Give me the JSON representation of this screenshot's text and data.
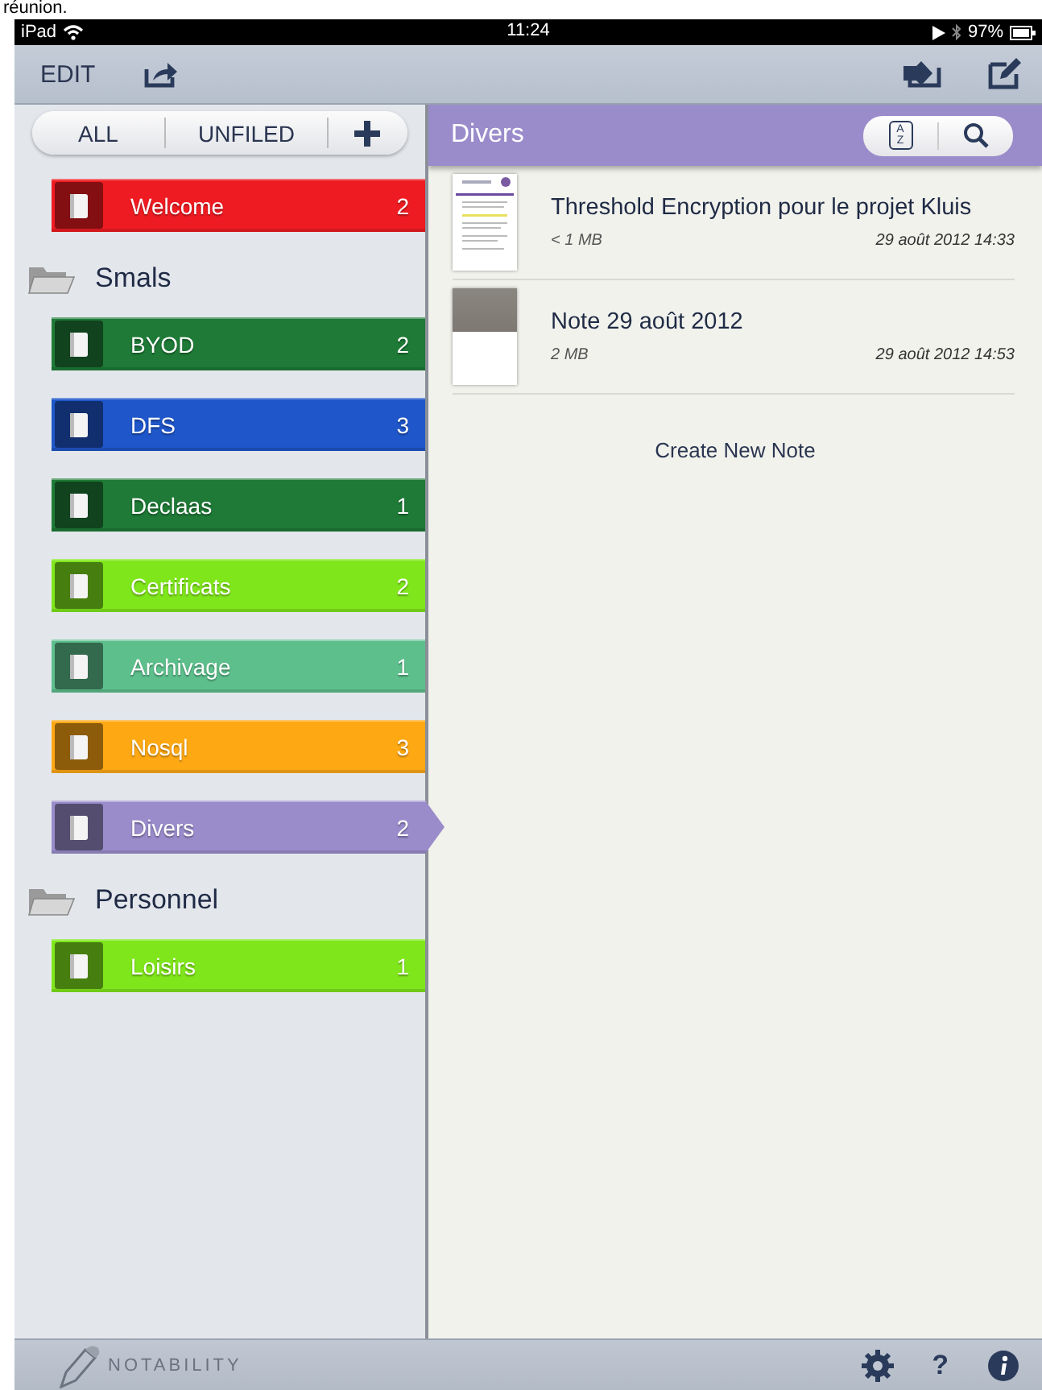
{
  "cropped_caption": "réunion.",
  "status_bar": {
    "device": "iPad",
    "time": "11:24",
    "battery": "97%"
  },
  "toolbar": {
    "edit": "EDIT"
  },
  "sidebar": {
    "filters": [
      "ALL",
      "UNFILED"
    ],
    "items": [
      {
        "kind": "notebook",
        "label": "Welcome",
        "count": "2",
        "color": "#ee1c22",
        "selected": false
      },
      {
        "kind": "section",
        "label": "Smals",
        "children": [
          {
            "kind": "notebook",
            "label": "BYOD",
            "count": "2",
            "color": "#1e7a36",
            "selected": false
          },
          {
            "kind": "notebook",
            "label": "DFS",
            "count": "3",
            "color": "#1f56c9",
            "selected": false
          },
          {
            "kind": "notebook",
            "label": "Declaas",
            "count": "1",
            "color": "#1e7a36",
            "selected": false
          },
          {
            "kind": "notebook",
            "label": "Certificats",
            "count": "2",
            "color": "#80e61c",
            "selected": false
          },
          {
            "kind": "notebook",
            "label": "Archivage",
            "count": "1",
            "color": "#5dbf8c",
            "selected": false
          },
          {
            "kind": "notebook",
            "label": "Nosql",
            "count": "3",
            "color": "#fea814",
            "selected": false
          },
          {
            "kind": "notebook",
            "label": "Divers",
            "count": "2",
            "color": "#9a8ccb",
            "selected": true
          }
        ]
      },
      {
        "kind": "section",
        "label": "Personnel",
        "children": [
          {
            "kind": "notebook",
            "label": "Loisirs",
            "count": "1",
            "color": "#80e61c",
            "selected": false
          }
        ]
      }
    ]
  },
  "content": {
    "title": "Divers",
    "sort_button": {
      "top": "A",
      "bottom": "Z"
    },
    "notes": [
      {
        "title": "Threshold Encryption pour le projet Kluis",
        "size": "< 1 MB",
        "date": "29 août 2012 14:33",
        "kind": "document"
      },
      {
        "title": "Note 29 août 2012",
        "size": "2 MB",
        "date": "29 août 2012 14:53",
        "kind": "photo"
      }
    ],
    "create_link": "Create New Note"
  },
  "bottom_bar": {
    "app_name": "NOTABILITY",
    "help": "?"
  }
}
